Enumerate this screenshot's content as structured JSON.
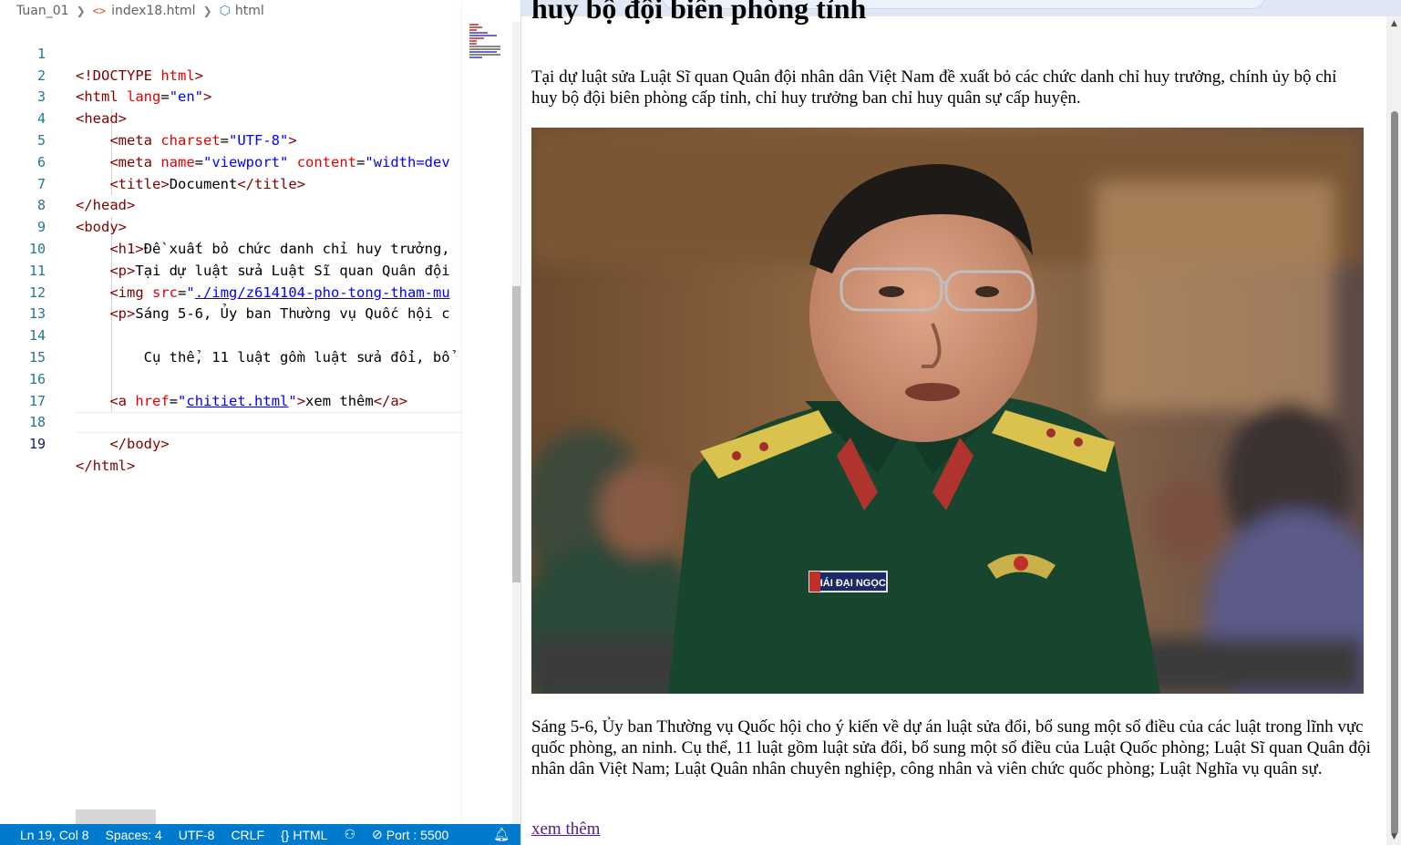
{
  "breadcrumb": {
    "items": [
      "Tuan_01",
      "index18.html",
      "html"
    ],
    "icons": [
      "chevron-right-icon",
      "html-file-icon",
      "element-cube-icon"
    ]
  },
  "editor": {
    "lines": [
      {
        "n": "1"
      },
      {
        "n": "2"
      },
      {
        "n": "3"
      },
      {
        "n": "4"
      },
      {
        "n": "5"
      },
      {
        "n": "6"
      },
      {
        "n": "7"
      },
      {
        "n": "8"
      },
      {
        "n": "9"
      },
      {
        "n": "10"
      },
      {
        "n": "11"
      },
      {
        "n": "12"
      },
      {
        "n": "13"
      },
      {
        "n": "14"
      },
      {
        "n": "15"
      },
      {
        "n": "16"
      },
      {
        "n": "17"
      },
      {
        "n": "18"
      },
      {
        "n": "19"
      }
    ],
    "code": {
      "doctype": "<!DOCTYPE",
      "doctype_html": "html",
      "html_tag": "html",
      "lang_attr": "lang",
      "lang_val": "\"en\"",
      "head_tag": "head",
      "meta_tag": "meta",
      "charset_attr": "charset",
      "charset_val": "\"UTF-8\"",
      "name_attr": "name",
      "name_val": "\"viewport\"",
      "content_attr": "content",
      "content_val": "\"width=dev",
      "title_tag": "title",
      "title_text": "Document",
      "body_tag": "body",
      "h1_tag": "h1",
      "h1_text": "Đề xuất bỏ chức danh chỉ huy trưởng,",
      "p_tag": "p",
      "p_text": "Tại dự luật sửa Luật Sĩ quan Quân đội",
      "img_tag": "img",
      "src_attr": "src",
      "src_val": "./img/z614104-pho-tong-tham-mu",
      "p2_text": "Sáng 5-6, Ủy ban Thường vụ Quốc hội c",
      "line14_text": "Cụ thể, 11 luật gồm luật sửa đổi, bổ",
      "a_tag": "a",
      "href_attr": "href",
      "href_val": "chitiet.html",
      "a_text": "xem thêm"
    }
  },
  "statusbar": {
    "position": "Ln 19, Col 8",
    "spaces": "Spaces: 4",
    "encoding": "UTF-8",
    "eol": "CRLF",
    "language": "HTML",
    "language_icon": "{}",
    "port": "Port : 5500"
  },
  "page": {
    "h1": "huy bộ đội biên phòng tỉnh",
    "intro": "Tại dự luật sửa Luật Sĩ quan Quân đội nhân dân Việt Nam đề xuất bỏ các chức danh chỉ huy trưởng, chính ủy bộ chỉ huy bộ đội biên phòng cấp tỉnh, chỉ huy trưởng ban chỉ huy quân sự cấp huyện.",
    "body_text": "Sáng 5-6, Ủy ban Thường vụ Quốc hội cho ý kiến về dự án luật sửa đổi, bổ sung một số điều của các luật trong lĩnh vực quốc phòng, an ninh. Cụ thể, 11 luật gồm luật sửa đổi, bổ sung một số điều của Luật Quốc phòng; Luật Sĩ quan Quân đội nhân dân Việt Nam; Luật Quân nhân chuyên nghiệp, công nhân và viên chức quốc phòng; Luật Nghĩa vụ quân sự.",
    "link_text": "xem thêm",
    "nametag": "THÁI ĐẠI NGỌC"
  },
  "colors": {
    "statusbar": "#007acc",
    "tag": "#800000",
    "attr": "#e50000",
    "value": "#0000ff",
    "line_number": "#237893",
    "visited_link": "#551a8b"
  }
}
